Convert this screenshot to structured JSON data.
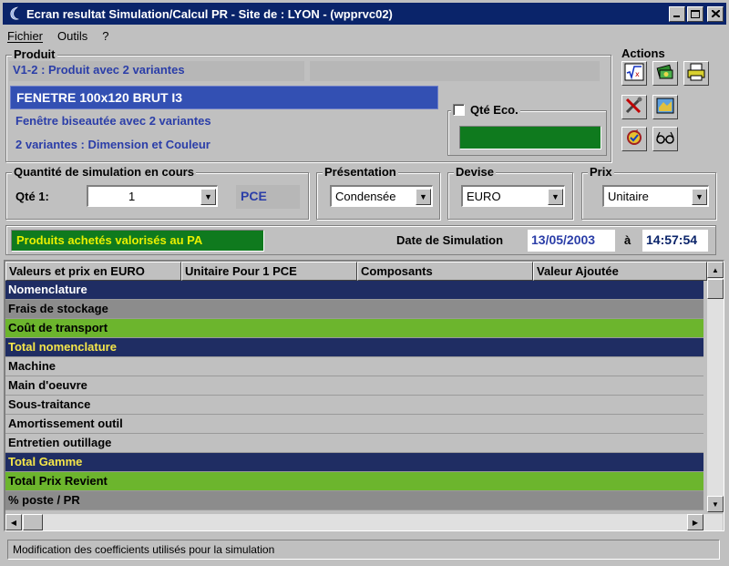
{
  "window": {
    "title": "Ecran resultat Simulation/Calcul PR - Site de : LYON - (wpprvc02)"
  },
  "menu": [
    "Fichier",
    "Outils",
    "?"
  ],
  "produit": {
    "group_label": "Produit",
    "code_line": "V1-2 : Produit avec 2 variantes",
    "reference": "FENETRE 100x120 BRUT I3",
    "description": "Fenêtre biseautée avec 2 variantes",
    "variantes": "2 variantes : Dimension et Couleur",
    "qte_eco_label": "Qté Eco."
  },
  "actions": {
    "group_label": "Actions"
  },
  "quantite": {
    "group_label": "Quantité de simulation en cours",
    "label": "Qté 1:",
    "value": "1",
    "unit": "PCE"
  },
  "presentation": {
    "group_label": "Présentation",
    "value": "Condensée"
  },
  "devise": {
    "group_label": "Devise",
    "value": "EURO"
  },
  "prix": {
    "group_label": "Prix",
    "value": "Unitaire"
  },
  "info": {
    "valorisation": "Produits achetés valorisés au PA",
    "date_label": "Date de Simulation",
    "date": "13/05/2003",
    "a_label": "à",
    "time": "14:57:54"
  },
  "grid": {
    "columns": [
      "Valeurs et prix en EURO",
      "Unitaire Pour 1 PCE",
      "Composants",
      "Valeur Ajoutée"
    ],
    "rows": [
      {
        "label": "Nomenclature",
        "style": "navy-white"
      },
      {
        "label": "Frais de stockage",
        "style": "gray"
      },
      {
        "label": "Coût de transport",
        "style": "green"
      },
      {
        "label": "Total nomenclature",
        "style": "navy-yellow"
      },
      {
        "label": "Machine",
        "style": "light"
      },
      {
        "label": "Main d'oeuvre",
        "style": "light"
      },
      {
        "label": "Sous-traitance",
        "style": "light"
      },
      {
        "label": "Amortissement outil",
        "style": "light"
      },
      {
        "label": "Entretien outillage",
        "style": "light"
      },
      {
        "label": "Total Gamme",
        "style": "navy-yellow"
      },
      {
        "label": "Total Prix Revient",
        "style": "green"
      },
      {
        "label": "% poste / PR",
        "style": "gray"
      }
    ]
  },
  "status": {
    "text": "Modification des coefficients utilisés pour la simulation"
  },
  "colors": {
    "title_bar": "#0a246a",
    "navy_row": "#1f2d63",
    "green_row": "#6cb52d",
    "gray_row": "#8c8c8c",
    "light_row": "#c0c0c0",
    "yellow_text": "#f5e64a",
    "blue_text": "#2b3ea8",
    "qte_eco_box": "#0f7a1e"
  }
}
